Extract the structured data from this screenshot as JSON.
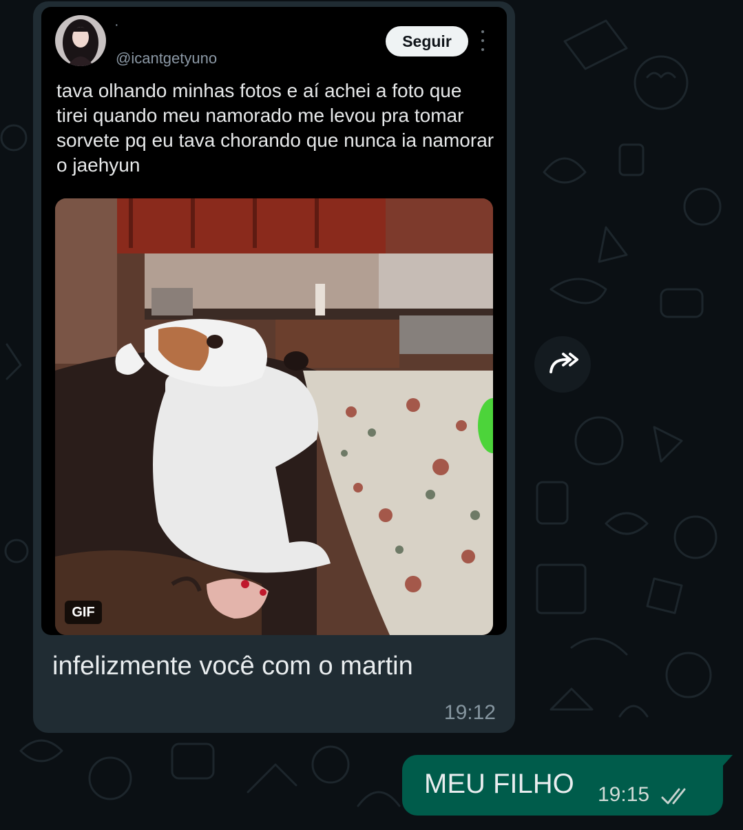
{
  "tweet": {
    "author_mark": "·",
    "handle": "@icantgetyuno",
    "follow_label": "Seguir",
    "text": "tava olhando minhas fotos e aí achei a foto que tirei quando meu namorado me levou pra tomar sorvete pq eu tava chorando que nunca ia namorar o jaehyun",
    "media_badge": "GIF"
  },
  "incoming": {
    "caption": "infelizmente você com o martin",
    "time": "19:12"
  },
  "outgoing": {
    "text": "MEU FILHO",
    "time": "19:15",
    "status_icon": "double-check-icon"
  },
  "icons": {
    "forward": "forward-icon",
    "more": "more-vertical-icon"
  },
  "colors": {
    "background": "#0b1014",
    "incoming_bubble": "#202c33",
    "outgoing_bubble": "#005c4b",
    "follow_button": "#eff3f4"
  }
}
